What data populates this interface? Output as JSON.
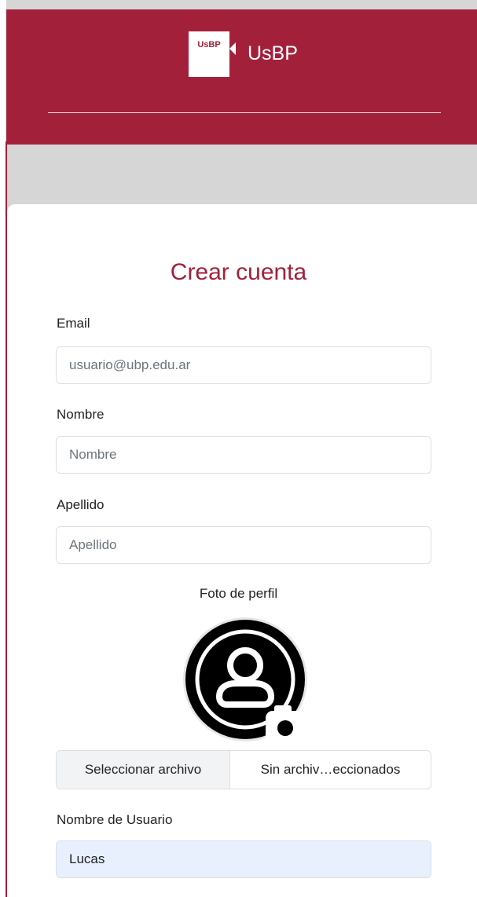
{
  "header": {
    "logo_text": "UsBP",
    "brand_name": "UsBP"
  },
  "form": {
    "title": "Crear cuenta",
    "email": {
      "label": "Email",
      "placeholder": "usuario@ubp.edu.ar",
      "value": ""
    },
    "nombre": {
      "label": "Nombre",
      "placeholder": "Nombre",
      "value": ""
    },
    "apellido": {
      "label": "Apellido",
      "placeholder": "Apellido",
      "value": ""
    },
    "foto": {
      "label": "Foto de perfil",
      "icon": "user-circle-camera-icon"
    },
    "file": {
      "button_label": "Seleccionar archivo",
      "status": "Sin archiv…eccionados"
    },
    "usuario": {
      "label": "Nombre de Usuario",
      "value": "Lucas"
    }
  },
  "colors": {
    "brand": "#a3203a",
    "background": "#d6d6d6",
    "autofill": "#e8f0fe"
  }
}
